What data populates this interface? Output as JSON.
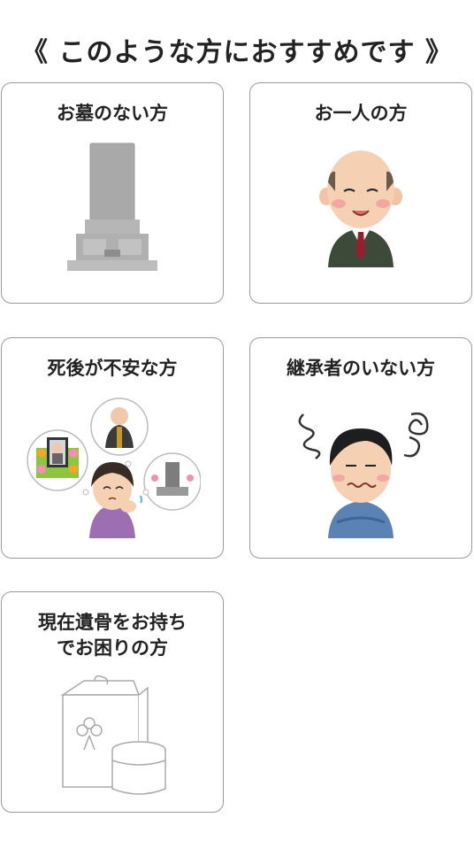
{
  "heading": "《 このような方におすすめです 》",
  "cards": [
    {
      "title": "お墓のない方",
      "icon": "gravestone-icon"
    },
    {
      "title": "お一人の方",
      "icon": "elderly-man-icon"
    },
    {
      "title": "死後が不安な方",
      "icon": "worried-woman-icon"
    },
    {
      "title": "継承者のいない方",
      "icon": "confused-man-icon"
    },
    {
      "title_line1": "現在遺骨をお持ち",
      "title_line2": "でお困りの方",
      "icon": "urn-box-icon"
    }
  ]
}
